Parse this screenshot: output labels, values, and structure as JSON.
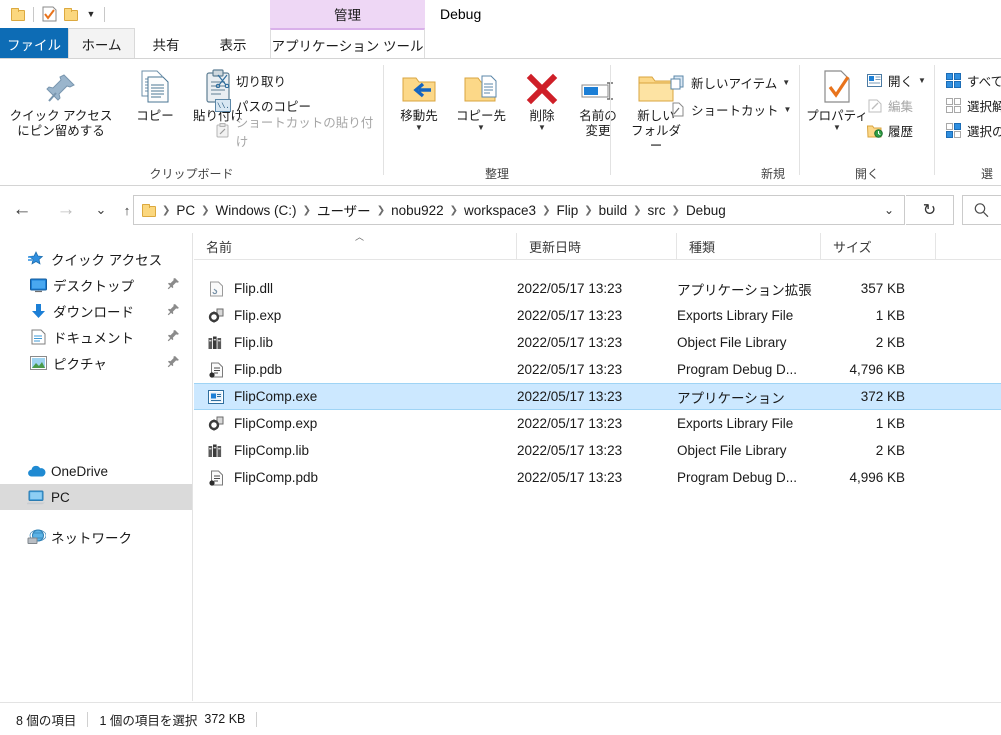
{
  "window": {
    "title": "Debug",
    "contextual_tab_group": "管理",
    "quick_access": [
      {
        "name": "folder-icon",
        "label": "folder"
      },
      {
        "name": "properties-icon",
        "label": "properties"
      },
      {
        "name": "new-folder-icon",
        "label": "new-folder"
      },
      {
        "name": "customize-caret-icon",
        "label": "▾"
      }
    ]
  },
  "tabs": [
    {
      "id": "file",
      "label": "ファイル"
    },
    {
      "id": "home",
      "label": "ホーム"
    },
    {
      "id": "share",
      "label": "共有"
    },
    {
      "id": "view",
      "label": "表示"
    },
    {
      "id": "apptools",
      "label": "アプリケーション ツール"
    }
  ],
  "ribbon": {
    "groups": [
      {
        "id": "clipboard",
        "label": "クリップボード",
        "big_buttons": [
          {
            "id": "pin-to-quick-access",
            "line1": "クイック アクセス",
            "line2": "にピン留めする",
            "icon": "pin-icon"
          },
          {
            "id": "copy",
            "line1": "コピー",
            "line2": "",
            "icon": "copy-icon"
          },
          {
            "id": "paste",
            "line1": "貼り付け",
            "line2": "",
            "icon": "paste-icon"
          }
        ],
        "small_buttons": [
          {
            "id": "cut",
            "label": "切り取り",
            "icon": "scissors-icon",
            "disabled": false
          },
          {
            "id": "copy-path",
            "label": "パスのコピー",
            "icon": "copy-path-icon",
            "disabled": false
          },
          {
            "id": "paste-shortcut",
            "label": "ショートカットの貼り付け",
            "icon": "paste-shortcut-icon",
            "disabled": true
          }
        ]
      },
      {
        "id": "organize",
        "label": "整理",
        "big_buttons": [
          {
            "id": "move-to",
            "line1": "移動先",
            "line2": "",
            "icon": "move-to-icon",
            "caret": true
          },
          {
            "id": "copy-to",
            "line1": "コピー先",
            "line2": "",
            "icon": "copy-to-icon",
            "caret": true
          },
          {
            "id": "delete",
            "line1": "削除",
            "line2": "",
            "icon": "delete-icon",
            "caret": true
          },
          {
            "id": "rename",
            "line1": "名前の",
            "line2": "変更",
            "icon": "rename-icon",
            "caret": false
          }
        ],
        "small_buttons": []
      },
      {
        "id": "new",
        "label": "新規",
        "big_buttons": [
          {
            "id": "new-folder",
            "line1": "新しい",
            "line2": "フォルダー",
            "icon": "new-folder-icon",
            "caret": false
          }
        ],
        "small_buttons": [
          {
            "id": "new-item",
            "label": "新しいアイテム",
            "icon": "new-item-icon",
            "caret": true,
            "disabled": false
          },
          {
            "id": "easy-access",
            "label": "ショートカット",
            "icon": "shortcut-icon",
            "caret": true,
            "disabled": false
          }
        ]
      },
      {
        "id": "open",
        "label": "開く",
        "big_buttons": [
          {
            "id": "properties",
            "line1": "プロパティ",
            "line2": "",
            "icon": "properties-icon",
            "caret": true
          }
        ],
        "small_buttons": [
          {
            "id": "open",
            "label": "開く",
            "icon": "open-icon",
            "caret": true,
            "disabled": false
          },
          {
            "id": "edit",
            "label": "編集",
            "icon": "edit-icon",
            "caret": false,
            "disabled": true
          },
          {
            "id": "history",
            "label": "履歴",
            "icon": "history-icon",
            "caret": false,
            "disabled": false
          }
        ]
      },
      {
        "id": "select",
        "label": "選",
        "big_buttons": [],
        "small_buttons": [
          {
            "id": "select-all",
            "label": "すべて",
            "icon": "select-all-icon",
            "disabled": false
          },
          {
            "id": "select-none",
            "label": "選択解",
            "icon": "select-none-icon",
            "disabled": false
          },
          {
            "id": "invert-selection",
            "label": "選択の",
            "icon": "invert-selection-icon",
            "disabled": false
          }
        ]
      }
    ]
  },
  "navigation": {
    "back_icon": "arrow-left-icon",
    "forward_icon": "arrow-right-icon",
    "recent_icon": "chevron-down-icon",
    "up_icon": "arrow-up-icon",
    "refresh_icon": "refresh-icon",
    "search_icon": "search-icon",
    "breadcrumbs": [
      "PC",
      "Windows (C:)",
      "ユーザー",
      "nobu922",
      "workspace3",
      "Flip",
      "build",
      "src",
      "Debug"
    ]
  },
  "sidebar": {
    "items": [
      {
        "id": "quick-access",
        "label": "クイック アクセス",
        "icon": "star-icon",
        "indent": false,
        "pinned": false,
        "selected": false
      },
      {
        "id": "desktop",
        "label": "デスクトップ",
        "icon": "desktop-icon",
        "indent": true,
        "pinned": true,
        "selected": false
      },
      {
        "id": "downloads",
        "label": "ダウンロード",
        "icon": "download-icon",
        "indent": true,
        "pinned": true,
        "selected": false
      },
      {
        "id": "documents",
        "label": "ドキュメント",
        "icon": "documents-icon",
        "indent": true,
        "pinned": true,
        "selected": false
      },
      {
        "id": "pictures",
        "label": "ピクチャ",
        "icon": "pictures-icon",
        "indent": true,
        "pinned": true,
        "selected": false
      },
      {
        "id": "onedrive",
        "label": "OneDrive",
        "icon": "onedrive-icon",
        "indent": false,
        "pinned": false,
        "selected": false
      },
      {
        "id": "pc",
        "label": "PC",
        "icon": "pc-icon",
        "indent": false,
        "pinned": false,
        "selected": true
      },
      {
        "id": "network",
        "label": "ネットワーク",
        "icon": "network-icon",
        "indent": false,
        "pinned": false,
        "selected": false
      }
    ]
  },
  "file_list": {
    "columns": [
      {
        "id": "name",
        "label": "名前",
        "sorted": true,
        "sort_dir": "asc"
      },
      {
        "id": "date",
        "label": "更新日時",
        "sorted": false
      },
      {
        "id": "type",
        "label": "種類",
        "sorted": false
      },
      {
        "id": "size",
        "label": "サイズ",
        "sorted": false
      }
    ],
    "rows": [
      {
        "name": "Flip.dll",
        "date": "2022/05/17 13:23",
        "type": "アプリケーション拡張",
        "size": "357 KB",
        "icon": "dll-icon",
        "selected": false
      },
      {
        "name": "Flip.exp",
        "date": "2022/05/17 13:23",
        "type": "Exports Library File",
        "size": "1 KB",
        "icon": "exp-icon",
        "selected": false
      },
      {
        "name": "Flip.lib",
        "date": "2022/05/17 13:23",
        "type": "Object File Library",
        "size": "2 KB",
        "icon": "lib-icon",
        "selected": false
      },
      {
        "name": "Flip.pdb",
        "date": "2022/05/17 13:23",
        "type": "Program Debug D...",
        "size": "4,796 KB",
        "icon": "pdb-icon",
        "selected": false
      },
      {
        "name": "FlipComp.exe",
        "date": "2022/05/17 13:23",
        "type": "アプリケーション",
        "size": "372 KB",
        "icon": "exe-icon",
        "selected": true
      },
      {
        "name": "FlipComp.exp",
        "date": "2022/05/17 13:23",
        "type": "Exports Library File",
        "size": "1 KB",
        "icon": "exp-icon",
        "selected": false
      },
      {
        "name": "FlipComp.lib",
        "date": "2022/05/17 13:23",
        "type": "Object File Library",
        "size": "2 KB",
        "icon": "lib-icon",
        "selected": false
      },
      {
        "name": "FlipComp.pdb",
        "date": "2022/05/17 13:23",
        "type": "Program Debug D...",
        "size": "4,996 KB",
        "icon": "pdb-icon",
        "selected": false
      }
    ]
  },
  "status": {
    "item_count": "8 個の項目",
    "selection": "1 個の項目を選択",
    "selection_size": "372 KB"
  },
  "colors": {
    "accent": "#0d6cb5",
    "selection_fill": "#cce8ff",
    "selection_border": "#9fd4f5",
    "contextual_tab": "#eed7f5",
    "nav_selected": "#dadada"
  }
}
